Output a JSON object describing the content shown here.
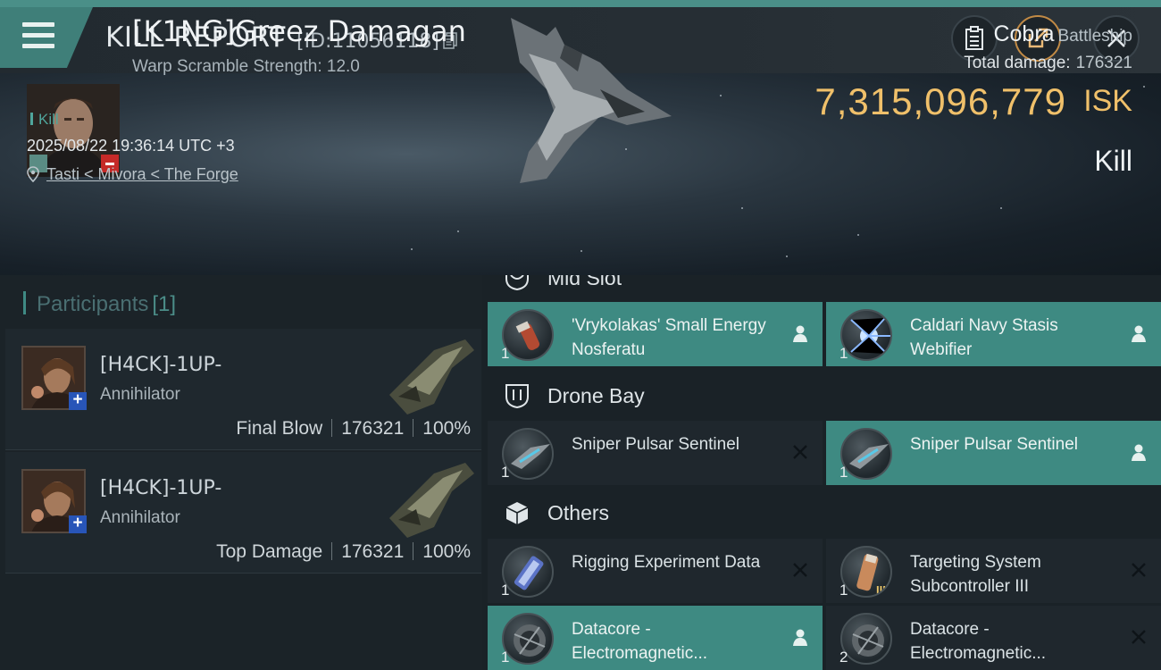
{
  "header": {
    "title": "KILL REPORT",
    "report_id": "[ID:11056118]"
  },
  "victim": {
    "name": "[K1NG]Greez Damagan",
    "warp_scramble": "Warp Scramble Strength: 12.0",
    "kill_tag": "Kill",
    "timestamp": "2025/08/22 19:36:14 UTC +3",
    "location": "Tasti < Mivora < The Forge",
    "ship_name": "Cobra",
    "ship_class": "Battleship",
    "total_damage_label": "Total damage:",
    "total_damage": "176321",
    "isk_value": "7,315,096,779",
    "isk_unit": "ISK",
    "result": "Kill"
  },
  "participants": {
    "title": "Participants",
    "count": "[1]",
    "rows": [
      {
        "name": "[H4CK]-1UP-",
        "ship": "Annihilator",
        "role": "Final Blow",
        "damage": "176321",
        "percent": "100%"
      },
      {
        "name": "[H4CK]-1UP-",
        "ship": "Annihilator",
        "role": "Top Damage",
        "damage": "176321",
        "percent": "100%"
      }
    ]
  },
  "fitting": {
    "mid_slot": {
      "title": "Mid Slot"
    },
    "mid_items": [
      {
        "qty": "1",
        "name": "'Vrykolakas' Small Energy Nosferatu",
        "state": "fitted"
      },
      {
        "qty": "1",
        "name": "Caldari Navy Stasis Webifier",
        "state": "fitted"
      }
    ],
    "drone_bay": {
      "title": "Drone Bay"
    },
    "drone_items": [
      {
        "qty": "1",
        "name": "Sniper Pulsar Sentinel",
        "state": "destroyed"
      },
      {
        "qty": "1",
        "name": "Sniper Pulsar Sentinel",
        "state": "fitted"
      }
    ],
    "others": {
      "title": "Others"
    },
    "other_items": [
      {
        "qty": "1",
        "name": "Rigging Experiment Data",
        "state": "destroyed"
      },
      {
        "qty": "1",
        "name": "Targeting System Subcontroller III",
        "state": "destroyed"
      },
      {
        "qty": "1",
        "name": "Datacore - Electromagnetic...",
        "state": "fitted"
      },
      {
        "qty": "2",
        "name": "Datacore - Electromagnetic...",
        "state": "destroyed"
      }
    ]
  },
  "colors": {
    "accent_teal": "#3e8a82",
    "isk_gold": "#f0c06a",
    "danger_red": "#c52a28"
  }
}
